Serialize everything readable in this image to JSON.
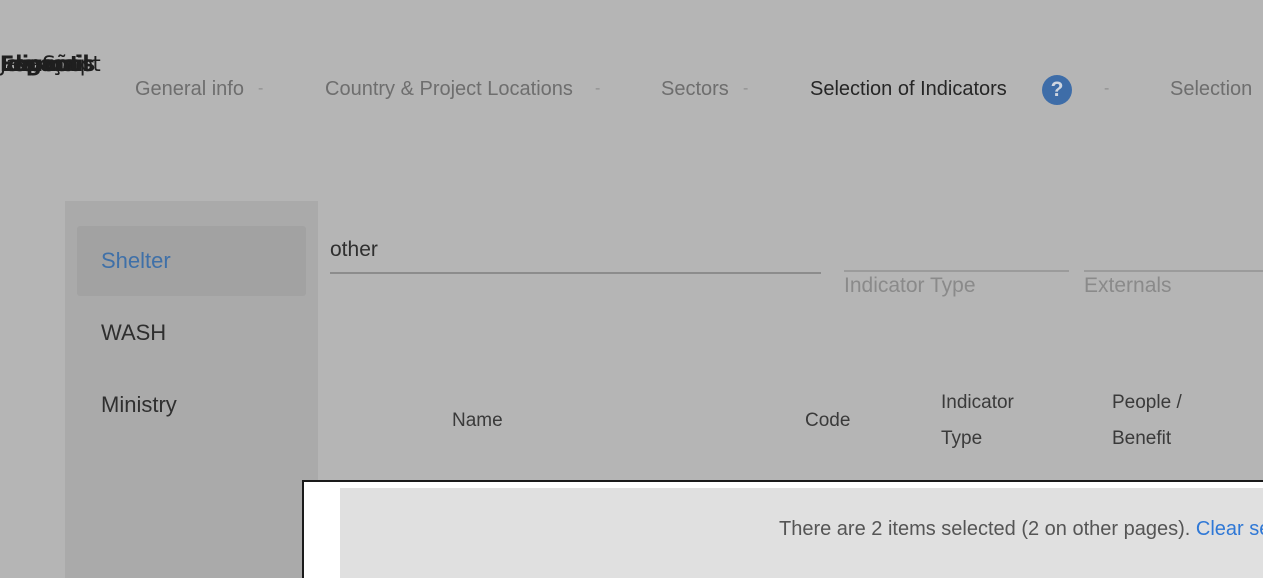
{
  "overlap_labels": [
    "JavaScript",
    "Idioma",
    "Español",
    "Français",
    "Logout"
  ],
  "stepper": {
    "steps": [
      {
        "label": "General info"
      },
      {
        "label": "Country & Project Locations"
      },
      {
        "label": "Sectors"
      },
      {
        "label": "Selection of Indicators"
      },
      {
        "label": "Selection"
      }
    ],
    "separator": "-",
    "help_icon": "?"
  },
  "sidebar": {
    "items": [
      {
        "label": "Shelter",
        "active": true
      },
      {
        "label": "WASH",
        "active": false
      },
      {
        "label": "Ministry",
        "active": false
      }
    ]
  },
  "filters": {
    "search_value": "other",
    "indicator_type_placeholder": "Indicator Type",
    "externals_placeholder": "Externals"
  },
  "table": {
    "headers": {
      "name": "Name",
      "code": "Code",
      "indicator_type_line1": "Indicator",
      "indicator_type_line2": "Type",
      "people_line1": "People /",
      "people_line2": "Benefit"
    }
  },
  "selection_bar": {
    "message": "There are 2 items selected (2 on other pages).",
    "clear_link": "Clear selection"
  },
  "colors": {
    "background": "#b5b5b5",
    "accent": "#3f70a8",
    "link": "#2f78d6"
  }
}
